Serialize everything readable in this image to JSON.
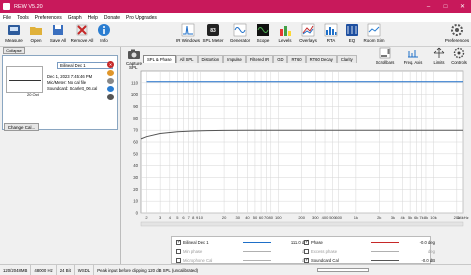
{
  "window": {
    "title": "REW V5.20"
  },
  "menu": [
    "File",
    "Tools",
    "Preferences",
    "Graph",
    "Help",
    "Donate",
    "Pro Upgrades"
  ],
  "toolbar": {
    "left": [
      {
        "label": "Measure",
        "icon": "measure-icon",
        "color": "#2d5b9c"
      },
      {
        "label": "Open",
        "icon": "open-folder-icon",
        "color": "#e0b13a"
      },
      {
        "label": "Save All",
        "icon": "save-icon",
        "color": "#3a6fbf"
      },
      {
        "label": "Remove All",
        "icon": "remove-icon",
        "color": "#c62828"
      },
      {
        "label": "Info",
        "icon": "info-icon",
        "color": "#2a7dd1"
      }
    ],
    "right": [
      {
        "label": "IR Windows",
        "icon": "ir-windows-icon"
      },
      {
        "label": "SPL Meter",
        "icon": "spl-meter-icon",
        "value": "83"
      },
      {
        "label": "Generator",
        "icon": "generator-icon"
      },
      {
        "label": "Scope",
        "icon": "scope-icon"
      },
      {
        "label": "Levels",
        "icon": "levels-icon"
      },
      {
        "label": "Overlays",
        "icon": "overlays-icon"
      },
      {
        "label": "RTA",
        "icon": "rta-icon"
      },
      {
        "label": "EQ",
        "icon": "eq-icon"
      },
      {
        "label": "Room Sim",
        "icon": "room-sim-icon"
      }
    ],
    "preferences": "Preferences"
  },
  "left_panel": {
    "collapse_label": "Collapse",
    "measurement": {
      "name": "Bilineal Dec 1",
      "date": "Dec 1, 2023 7:45:46 PM",
      "mic": "Mic/Meter: No cal file",
      "soundcard": "Soundcard: Scarlett_06.cal",
      "number": "20 Oct"
    },
    "change_cal_label": "Change Cal..."
  },
  "graph": {
    "capture_label": "Capture",
    "tabs": [
      "SPL & Phase",
      "All SPL",
      "Distortion",
      "Impulse",
      "Filtered IR",
      "GD",
      "RT60",
      "RT60 Decay",
      "Clarity"
    ],
    "active_tab": 0,
    "controls": [
      "Scrollbars",
      "Freq. Axis",
      "Limits",
      "Controls"
    ],
    "y_axis_label": "SPL"
  },
  "chart_data": {
    "type": "line",
    "ylabel": "SPL",
    "ylim": [
      0,
      120
    ],
    "y_ticks": [
      0,
      10,
      20,
      30,
      40,
      50,
      60,
      70,
      80,
      90,
      100,
      110
    ],
    "x_ticks": [
      "2",
      "3",
      "4",
      "5",
      "6",
      "7",
      "8",
      "9",
      "10",
      "20",
      "30",
      "40",
      "50",
      "60",
      "70",
      "80",
      "100",
      "200",
      "300",
      "400",
      "500",
      "600",
      "1k",
      "2k",
      "3k",
      "4k",
      "5k",
      "6k",
      "7k",
      "8k",
      "10k",
      "20k",
      "24kHz"
    ],
    "x_tick_values": [
      2,
      3,
      4,
      5,
      6,
      7,
      8,
      9,
      10,
      20,
      30,
      40,
      50,
      60,
      70,
      80,
      100,
      200,
      300,
      400,
      500,
      600,
      1000,
      2000,
      3000,
      4000,
      5000,
      6000,
      7000,
      8000,
      10000,
      20000,
      24000
    ],
    "xlim": [
      1.7,
      24000
    ],
    "x_scale": "log",
    "grid": true,
    "series": [
      {
        "name": "Bilineal Dec 1",
        "color": "#1e6fc8",
        "x": [
          2,
          24000
        ],
        "y": [
          111,
          111
        ]
      },
      {
        "name": "Soundcard Cal",
        "color": "#555555",
        "x": [
          1.7,
          2,
          3,
          5,
          8,
          12,
          20,
          40,
          100,
          1000,
          24000
        ],
        "y": [
          62.6,
          64.5,
          67.2,
          68.6,
          69.3,
          69.6,
          69.8,
          69.9,
          70,
          70,
          70
        ]
      }
    ]
  },
  "legend": {
    "rows": [
      {
        "label": "Bilineal Dec 1",
        "value": "111.0 dB",
        "checked": true,
        "dim": false,
        "color": "#1e6fc8"
      },
      {
        "label": "Min phase",
        "value": "dB",
        "checked": false,
        "dim": true,
        "color": "#b0b0b0"
      },
      {
        "label": "Microphone Cal",
        "value": "dB",
        "checked": false,
        "dim": true,
        "color": "#b0b0b0"
      }
    ],
    "rows_right": [
      {
        "label": "Phase",
        "value": "-0.0 deg",
        "checked": true,
        "dim": false,
        "color": "#c62828"
      },
      {
        "label": "Excess phase",
        "value": "deg",
        "checked": false,
        "dim": true,
        "color": "#b0b0b0"
      },
      {
        "label": "Soundcard Cal",
        "value": "-0.0 dB",
        "checked": true,
        "dim": false,
        "color": "#555555"
      }
    ]
  },
  "status": {
    "ram": "120/2048MB",
    "rate": "48000 Hz",
    "bits": "24 Bit",
    "mode": "WSDL",
    "message": "Peak input before clipping 120 dB SPL (uncalibrated)"
  }
}
